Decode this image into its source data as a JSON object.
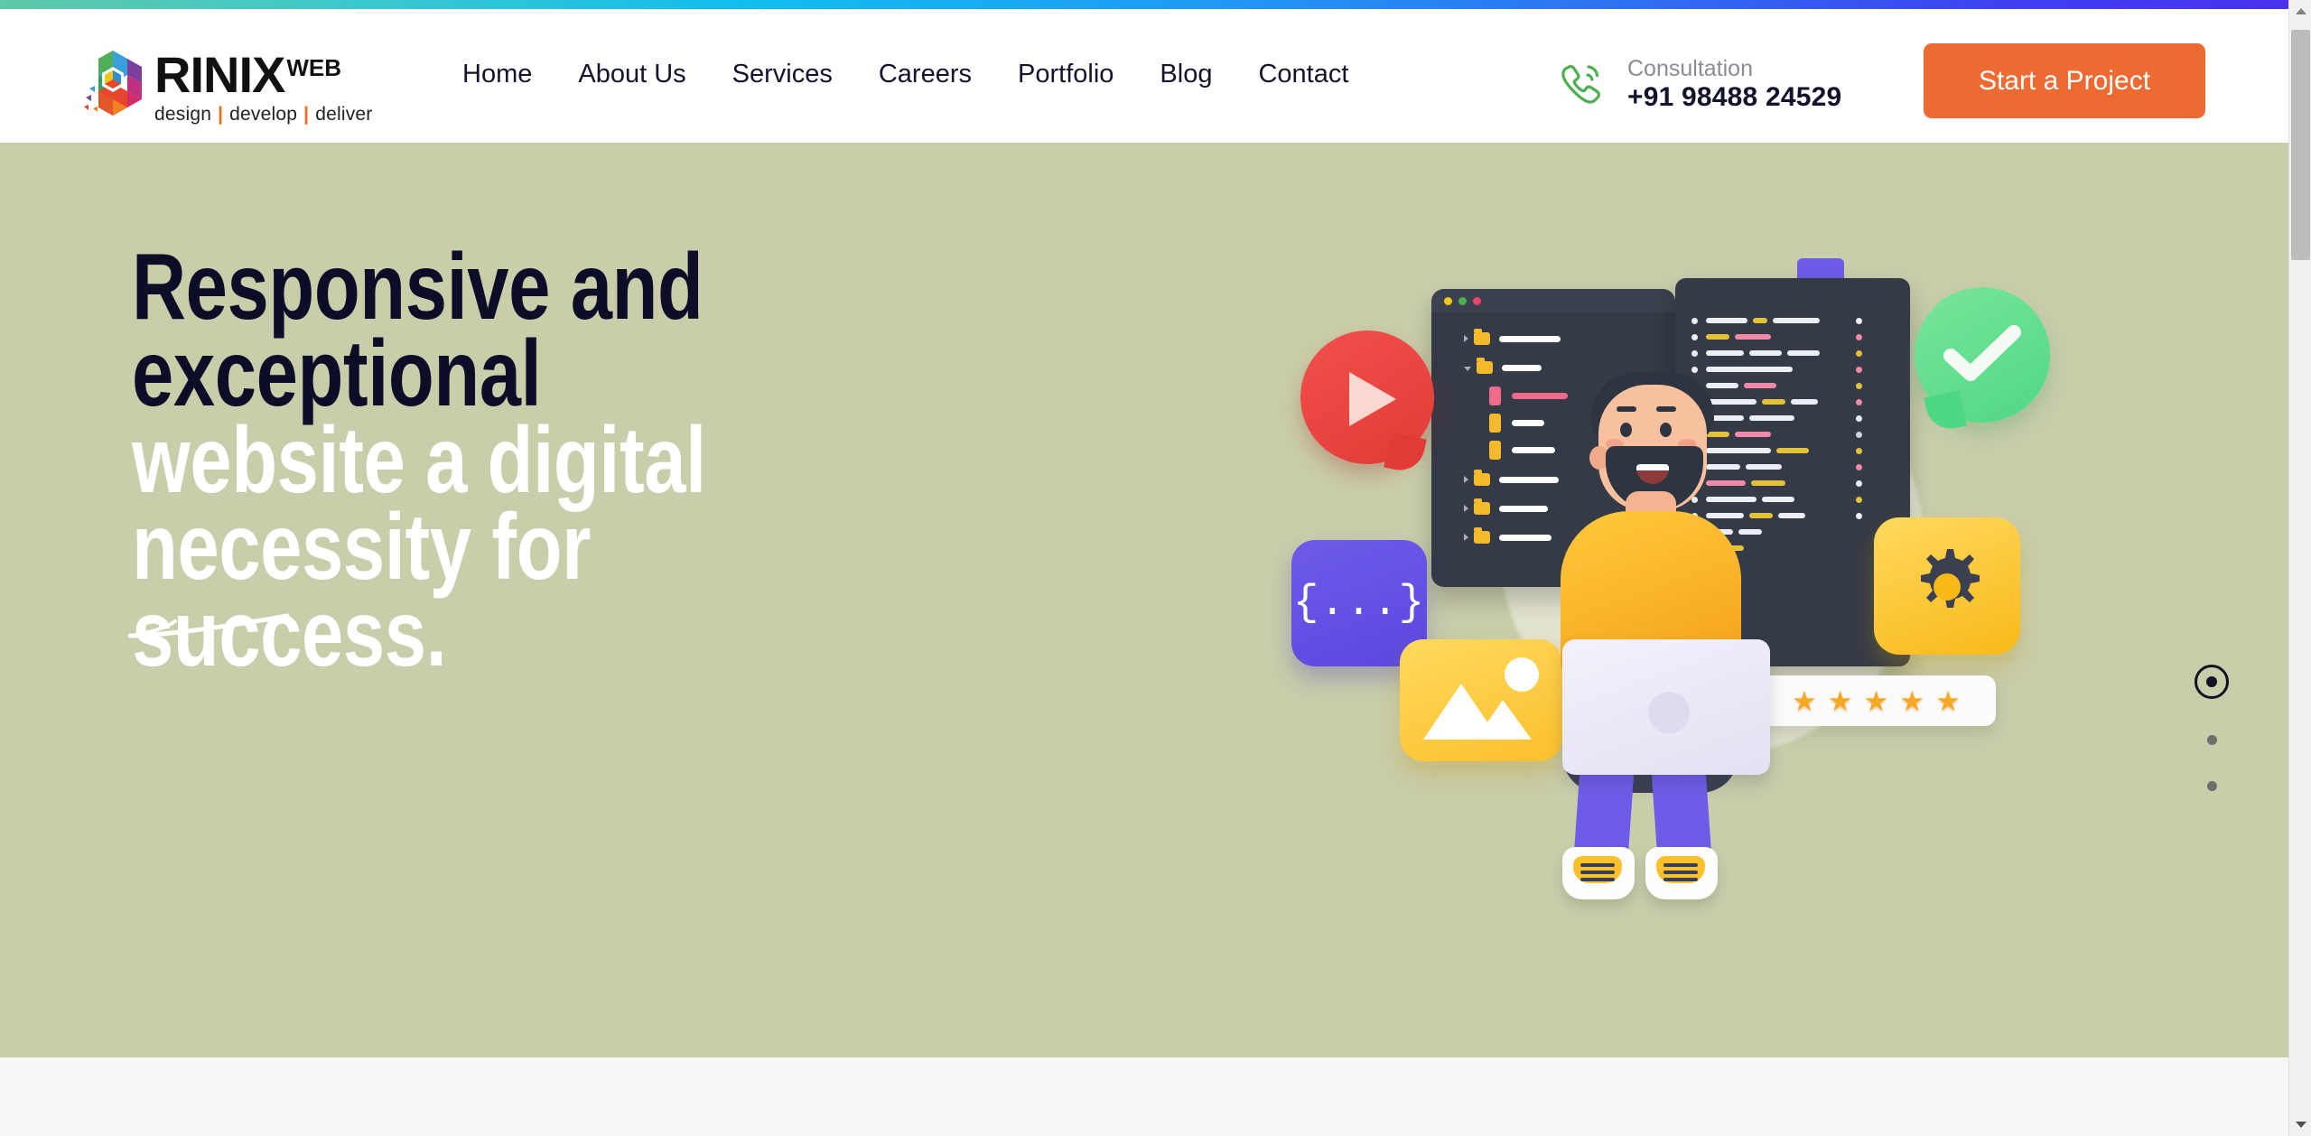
{
  "brand": {
    "name": "RINIX",
    "suffix": "WEB",
    "tagline_parts": [
      "design",
      "develop",
      "deliver"
    ],
    "separator": "|",
    "logo_icon": "rinix-hex-logo-icon",
    "separator_color": "#ef6c1a"
  },
  "nav": {
    "items": [
      {
        "label": "Home"
      },
      {
        "label": "About Us"
      },
      {
        "label": "Services"
      },
      {
        "label": "Careers"
      },
      {
        "label": "Portfolio"
      },
      {
        "label": "Blog"
      },
      {
        "label": "Contact"
      }
    ]
  },
  "consultation": {
    "icon": "phone-call-icon",
    "icon_color": "#4caf50",
    "label": "Consultation",
    "phone": "+91 98488 24529"
  },
  "cta": {
    "label": "Start a Project",
    "bg": "#ee6a33",
    "text_color": "#ffffff"
  },
  "hero": {
    "bg": "#c9cdaa",
    "heading_line1": "Responsive and exceptional",
    "heading_line2": "website a digital necessity for",
    "heading_line3": "success.",
    "line1_color": "#0d0d28",
    "line2_color": "#ffffff",
    "underline": "swoosh-underline-icon"
  },
  "carousel": {
    "dots": [
      {
        "state": "active"
      },
      {
        "state": "inactive"
      },
      {
        "state": "inactive"
      }
    ]
  },
  "illustration": {
    "name": "developer-3d-illustration",
    "elements": [
      {
        "name": "play-bubble-icon",
        "color": "#e23b36"
      },
      {
        "name": "check-bubble-icon",
        "color": "#4ed884"
      },
      {
        "name": "code-brackets-card",
        "text": "{...}",
        "color": "#5a47e0"
      },
      {
        "name": "image-placeholder-card",
        "color": "#fbc02d"
      },
      {
        "name": "gear-settings-card",
        "color": "#f8b919"
      },
      {
        "name": "file-tree-window",
        "color": "#343a46"
      },
      {
        "name": "code-editor-window",
        "color": "#343a46"
      },
      {
        "name": "rating-stars-card",
        "stars": 5,
        "star_color": "#f9a826"
      },
      {
        "name": "developer-character"
      }
    ]
  },
  "topbar": {
    "gradient_from": "#5fc9a8",
    "gradient_mid": "#11bdf0",
    "gradient_to": "#4a33ef"
  },
  "scrollbar": {
    "up_icon": "chevron-up-icon",
    "down_icon": "chevron-down-icon"
  }
}
